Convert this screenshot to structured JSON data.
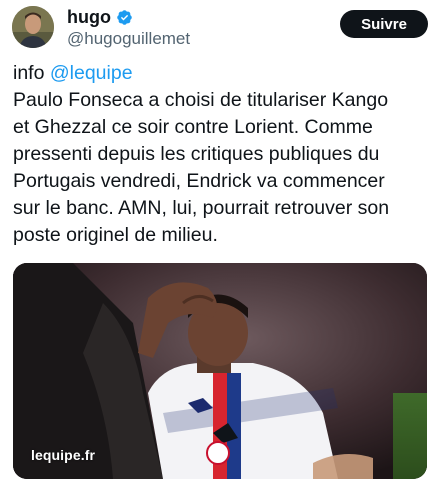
{
  "author": {
    "display_name": "hugo",
    "handle": "@hugoguillemet",
    "verified_icon": "verified-badge-icon"
  },
  "follow_button": {
    "label": "Suivre"
  },
  "tweet": {
    "prefix": "info ",
    "mention": "@lequipe",
    "body": "Paulo Fonseca a choisi de titulariser Kango\net Ghezzal ce soir contre Lorient. Comme\npressenti depuis les critiques publiques du\nPortugais vendredi, Endrick va commencer\nsur le banc. AMN, lui, pourrait retrouver son\nposte originel de milieu."
  },
  "media": {
    "watermark": "lequipe.fr",
    "crest_text": "OL"
  },
  "colors": {
    "accent": "#1d9bf0",
    "button_bg": "#0f1419",
    "text": "#0f1419",
    "muted": "#536471"
  }
}
